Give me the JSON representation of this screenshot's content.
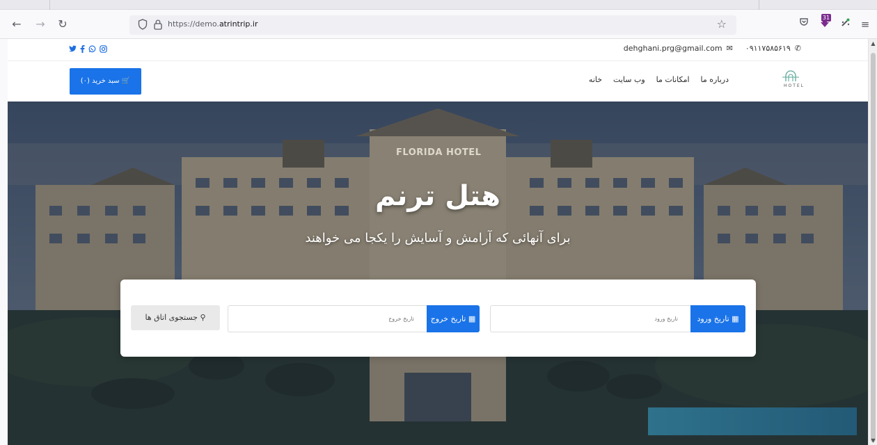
{
  "browser": {
    "url_host_prefix": "https://demo.",
    "url_host_domain": "atrintrip.ir",
    "extension_badge": "31"
  },
  "topbar": {
    "social_icons": [
      "twitter-icon",
      "facebook-icon",
      "whatsapp-icon",
      "instagram-icon"
    ],
    "email": "dehghani.prg@gmail.com",
    "phone": "۰۹۱۱۷۵۸۵۶۱۹"
  },
  "navbar": {
    "cart_label": "🛒 سبد خرید (۰)",
    "menu": [
      "خانه",
      "وب سایت",
      "امکانات ما",
      "درباره ما"
    ],
    "logo_text": "HOTEL"
  },
  "hero": {
    "sign": "FLORIDA HOTEL",
    "title": "هتل ترنم",
    "subtitle": "برای آنهائی که آرامش و آسایش را یکجا می خواهند"
  },
  "search": {
    "checkin_label": "تاریخ ورود",
    "checkin_placeholder": "تاریخ ورود",
    "checkout_label": "تاریخ خروج",
    "checkout_placeholder": "تاریخ خروج",
    "search_button": "جستجوی اتاق ها"
  },
  "colors": {
    "accent": "#1a73e8"
  }
}
